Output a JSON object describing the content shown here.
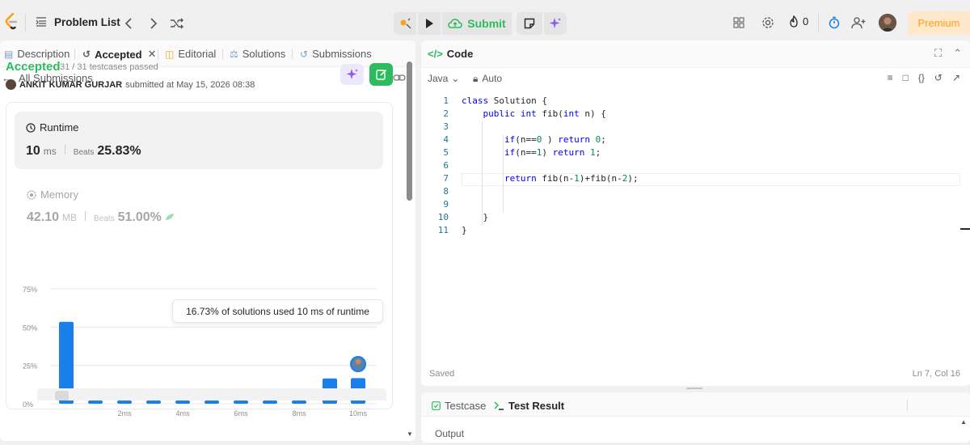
{
  "topbar": {
    "problem_list_label": "Problem List",
    "submit_label": "Submit",
    "streak_count": "0",
    "premium_label": "Premium"
  },
  "left": {
    "tabs": [
      {
        "label": "Description"
      },
      {
        "label": "Accepted"
      },
      {
        "label": "Editorial"
      },
      {
        "label": "Solutions"
      },
      {
        "label": "Submissions"
      }
    ],
    "all_submissions_label": "All Submissions",
    "status": "Accepted",
    "testcases": "31 / 31 testcases passed",
    "user": "ANKIT KUMAR GURJAR",
    "submitted_at": "submitted at May 15, 2026 08:38",
    "runtime": {
      "title": "Runtime",
      "value": "10",
      "unit": "ms",
      "beats_label": "Beats",
      "beats_value": "25.83%"
    },
    "memory": {
      "title": "Memory",
      "value": "42.10",
      "unit": "MB",
      "beats_label": "Beats",
      "beats_value": "51.00%"
    },
    "tooltip": "16.73% of solutions used 10 ms of runtime"
  },
  "chart_data": {
    "type": "bar",
    "categories": [
      "1ms",
      "2ms",
      "3ms",
      "4ms",
      "5ms",
      "6ms",
      "7ms",
      "8ms",
      "9ms",
      "10ms"
    ],
    "values": [
      53.5,
      1.5,
      1.5,
      1.5,
      1.5,
      1.5,
      1.5,
      1.5,
      1.5,
      16.73
    ],
    "extra_bars_before_last": [
      16.5
    ],
    "y_ticks": [
      "75%",
      "50%",
      "25%",
      "0%"
    ],
    "y_tick_values": [
      75,
      50,
      25,
      0
    ],
    "x_ticks": [
      "2ms",
      "4ms",
      "6ms",
      "8ms",
      "10ms"
    ],
    "ylim": [
      0,
      75
    ],
    "bar_color": "#1a7fe8",
    "highlight_category": "10ms"
  },
  "code": {
    "title": "Code",
    "language": "Java",
    "mode": "Auto",
    "lines": [
      "class Solution {",
      "    public int fib(int n) {",
      "",
      "        if(n==0 ) return 0;",
      "        if(n==1) return 1;",
      "",
      "        return fib(n-1)+fib(n-2);",
      "",
      "",
      "    }",
      "}"
    ],
    "line_numbers": [
      "1",
      "2",
      "3",
      "4",
      "5",
      "6",
      "7",
      "8",
      "9",
      "10",
      "11"
    ],
    "saved_label": "Saved",
    "cursor_pos": "Ln 7, Col 16"
  },
  "result": {
    "testcase_label": "Testcase",
    "test_result_label": "Test Result",
    "output_label": "Output"
  },
  "colors": {
    "accent_green": "#2cbb5d",
    "premium_orange": "#ffa116",
    "bar_blue": "#1a7fe8"
  }
}
